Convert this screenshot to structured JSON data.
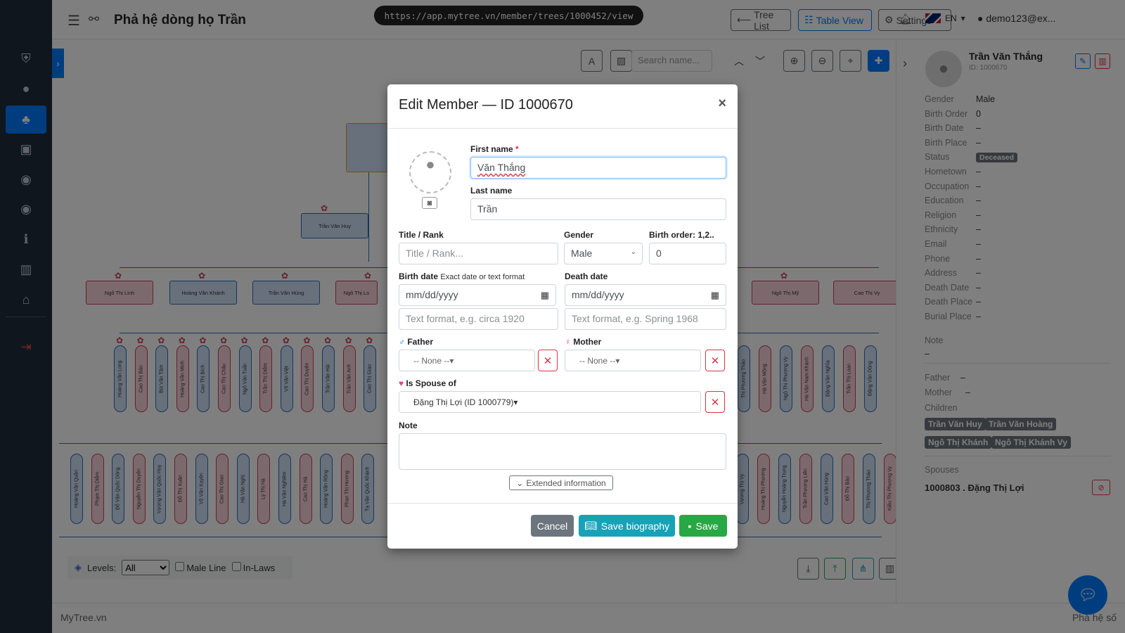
{
  "app": {
    "title": "Phả hệ dòng họ Trần",
    "url": "https://app.mytree.vn/member/trees/1000452/view",
    "footer_left": "MyTree.vn",
    "footer_right": "Phả hệ số"
  },
  "header": {
    "tree_list": "Tree List",
    "table_view": "Table View",
    "settings": "Settings",
    "lang": "EN",
    "user": "demo123@ex..."
  },
  "toolbar": {
    "search_placeholder": "Search name..."
  },
  "levels_bar": {
    "levels_label": "Levels:",
    "levels_value": "All",
    "male_line": "Male Line",
    "in_laws": "In-Laws"
  },
  "tree_nodes": {
    "gen2": [
      "Trần Văn Huy"
    ],
    "gen3": [
      "Ngô Thị Linh",
      "Hoàng Văn Khánh",
      "Trần Văn Hùng",
      "Ngô Thị Lo",
      "Ngô Thị Mỹ",
      "Cao Thị Vy"
    ],
    "gen4_left": [
      "Hoàng Văn Long",
      "Cao Thị Bảo",
      "Bùi Văn Tâm",
      "Hoàng Văn Minh",
      "Cao Thị Bích",
      "Cao Thị Châu",
      "Ngô Văn Tuấn",
      "Trần Thị Diễm",
      "Võ Văn Việt",
      "Cao Thị Duyên",
      "Trần Văn Hải",
      "Trần Văn Anh",
      "Cao Thị Giao"
    ],
    "gen4_right": [
      "Thị Phương Thảo",
      "Hà Văn Mộng",
      "Ngô Thị Phương Vy",
      "Hà Văn Nam Khánh",
      "Đặng Văn Nghĩa",
      "Trần Thị Loan",
      "Đặng Văn Dũng"
    ],
    "gen5_left": [
      "Hoàng Văn Quân",
      "Phạm Thị Diễm",
      "Đỗ Văn Quốc Dũng",
      "Nguyễn Thị Duyên",
      "Vương Văn Quốc Huy",
      "Đỗ Thị Xuân",
      "Võ Văn Xuyên",
      "Cao Thị Giao",
      "Hà Văn Nghị",
      "Lý Thị Hà",
      "Hà Văn Nghiêm",
      "Cao Thị Hà",
      "Hoàng Văn Rồng",
      "Phan Thị Hương",
      "Tạ Văn Quốc Khánh"
    ],
    "gen5_right": [
      "Vương Thị Vy",
      "Hoàng Thị Phương",
      "Nguyễn Hoàng Trung",
      "Trần Phương Liên",
      "Cao Văn Hùng",
      "Đỗ Thị Bảo",
      "Thị Phương Thảo",
      "Kiều Thị Phương Vy"
    ]
  },
  "right_panel": {
    "name": "Trần Văn Thắng",
    "id": "ID: 1000670",
    "fields": [
      {
        "label": "Gender",
        "value": "Male"
      },
      {
        "label": "Birth Order",
        "value": "0"
      },
      {
        "label": "Birth Date",
        "value": "–"
      },
      {
        "label": "Birth Place",
        "value": "–"
      },
      {
        "label": "Status",
        "value": "Deceased"
      },
      {
        "label": "Hometown",
        "value": "–"
      },
      {
        "label": "Occupation",
        "value": "–"
      },
      {
        "label": "Education",
        "value": "–"
      },
      {
        "label": "Religion",
        "value": "–"
      },
      {
        "label": "Ethnicity",
        "value": "–"
      },
      {
        "label": "Email",
        "value": "–"
      },
      {
        "label": "Phone",
        "value": "–"
      },
      {
        "label": "Address",
        "value": "–"
      },
      {
        "label": "Death Date",
        "value": "–"
      },
      {
        "label": "Death Place",
        "value": "–"
      },
      {
        "label": "Burial Place",
        "value": "–"
      }
    ],
    "note_label": "Note",
    "note_value": "–",
    "father_label": "Father",
    "father_value": "–",
    "mother_label": "Mother",
    "mother_value": "–",
    "children_label": "Children",
    "children": [
      "Trần Văn Huy",
      "Trần Văn Hoàng",
      "Ngô Thị Khánh",
      "Ngô Thị Khánh Vy"
    ],
    "spouses_label": "Spouses",
    "spouse": "1000803 . Đặng Thị Lợi"
  },
  "modal": {
    "title": "Edit Member — ID 1000670",
    "first_name_label": "First name",
    "first_name_required": "*",
    "first_name_value": "Văn Thắng",
    "last_name_label": "Last name",
    "last_name_value": "Trần",
    "title_rank_label": "Title / Rank",
    "title_rank_placeholder": "Title / Rank...",
    "gender_label": "Gender",
    "gender_value": "Male",
    "birth_order_label": "Birth order: 1,2..",
    "birth_order_value": "0",
    "birth_date_label": "Birth date",
    "birth_date_hint": "Exact date or text format",
    "birth_date_value": "mm/dd/yyyy",
    "birth_text_placeholder": "Text format, e.g. circa 1920",
    "death_date_label": "Death date",
    "death_date_value": "mm/dd/yyyy",
    "death_text_placeholder": "Text format, e.g. Spring 1968",
    "father_label": "Father",
    "father_value": "-- None --",
    "mother_label": "Mother",
    "mother_value": "-- None --",
    "spouse_label": "Is Spouse of",
    "spouse_value": "Đặng Thị Lợi (ID 1000779)",
    "note_label": "Note",
    "extended_label": "Extended information",
    "cancel": "Cancel",
    "save_bio": "Save biography",
    "save": "Save"
  },
  "colors": {
    "primary": "#007bff",
    "info": "#17a2b8",
    "success": "#28a745",
    "danger": "#dc3545",
    "secondary": "#6c757d",
    "sidebar": "#1f2d3d"
  }
}
